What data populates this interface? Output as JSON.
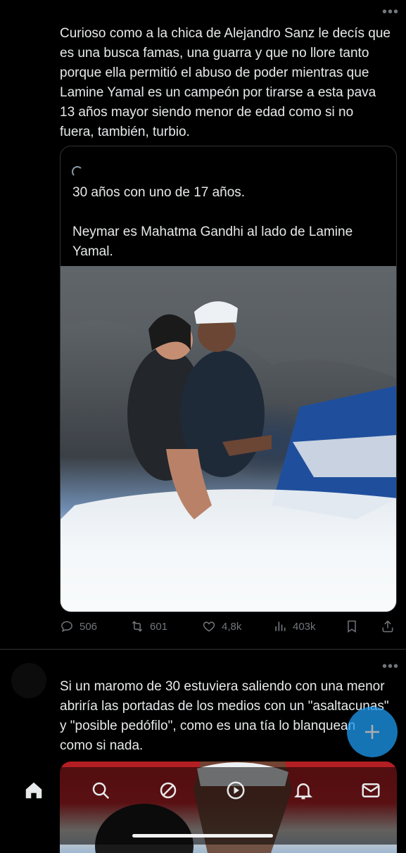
{
  "tweet1": {
    "text": "Curioso como a la chica de Alejandro Sanz le decís que es una busca famas, una guarra y que no llore tanto porque ella permitió el abuso de poder mientras que Lamine Yamal es un campeón por tirarse a esta pava 13 años mayor siendo menor de edad como si no fuera, también, turbio.",
    "quote": {
      "text": "30 años con uno de 17 años.\n\nNeymar es Mahatma Gandhi al lado de Lamine Yamal."
    },
    "actions": {
      "replies": "506",
      "reposts": "601",
      "likes": "4,8k",
      "views": "403k"
    }
  },
  "tweet2": {
    "text": "Si un maromo de 30 estuviera saliendo con una menor abriría las portadas de los medios con un \"asaltacunas\" y \"posible pedófilo\", como es una tía lo blanquean como si nada."
  },
  "more_glyph": "•••",
  "tabbar": {
    "items": [
      "home-icon",
      "search-icon",
      "grok-icon",
      "media-icon",
      "notifications-icon",
      "messages-icon"
    ]
  },
  "colors": {
    "background": "#000000",
    "text": "#e7e9ea",
    "muted": "#71767b",
    "accent": "#1d9bf0",
    "divider": "#2f3336"
  }
}
